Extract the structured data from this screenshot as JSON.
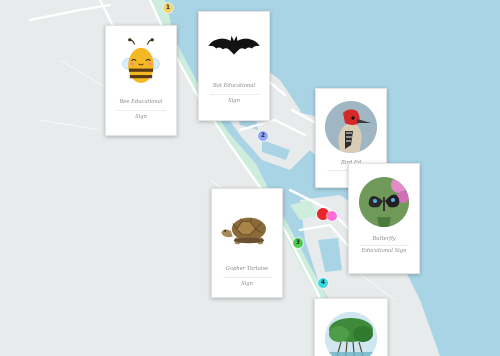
{
  "map": {
    "colors": {
      "water": "#a9d4e6",
      "land": "#e8ebec",
      "shore": "#cdeedd",
      "road": "#ffffff"
    }
  },
  "pins": [
    {
      "label": "1",
      "color": "#f3d36b",
      "icon": "numbered-marker"
    },
    {
      "label": "2",
      "color": "#8ea6ff",
      "icon": "numbered-marker"
    },
    {
      "label": "",
      "color": "#e8262c",
      "icon": "red-marker"
    },
    {
      "label": "",
      "color": "#ff6fd6",
      "icon": "magenta-marker"
    },
    {
      "label": "3",
      "color": "#4ccd4c",
      "icon": "numbered-marker"
    },
    {
      "label": "4",
      "color": "#37d8e2",
      "icon": "numbered-marker"
    }
  ],
  "cards": [
    {
      "title": "Bee Educational",
      "subtitle": "Sign",
      "icon": "bee-icon"
    },
    {
      "title": "Bat Educational",
      "subtitle": "Sign",
      "icon": "bat-icon"
    },
    {
      "title": "Bird Ed",
      "subtitle": "Si",
      "icon": "woodpecker-icon"
    },
    {
      "title": "Butterfly",
      "subtitle": "Educational Sign",
      "icon": "butterfly-icon"
    },
    {
      "title": "Gopher Tortoise",
      "subtitle": "Sign",
      "icon": "tortoise-icon"
    },
    {
      "title": "",
      "subtitle": "",
      "icon": "mangrove-photo"
    }
  ]
}
